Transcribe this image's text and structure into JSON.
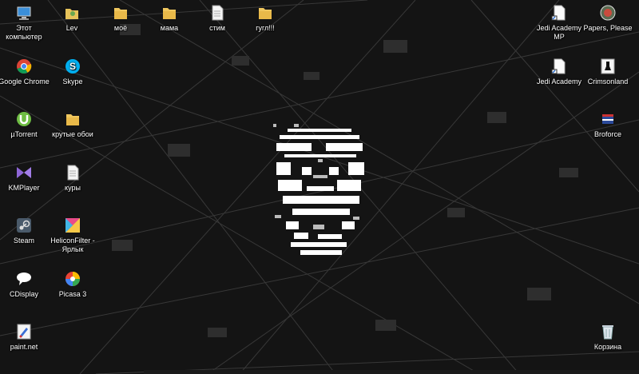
{
  "desktop": {
    "icons_left": [
      {
        "label": "Этот компьютер",
        "icon": "computer-icon"
      },
      {
        "label": "Lev",
        "icon": "user-folder-icon"
      },
      {
        "label": "моё",
        "icon": "folder-icon"
      },
      {
        "label": "мама",
        "icon": "folder-icon"
      },
      {
        "label": "стим",
        "icon": "text-file-icon"
      },
      {
        "label": "гугл!!!",
        "icon": "folder-icon"
      }
    ],
    "icons_col1": [
      {
        "label": "Google Chrome",
        "icon": "chrome-icon"
      },
      {
        "label": "µTorrent",
        "icon": "utorrent-icon"
      },
      {
        "label": "KMPlayer",
        "icon": "kmplayer-icon"
      },
      {
        "label": "Steam",
        "icon": "steam-icon"
      },
      {
        "label": "CDisplay",
        "icon": "cdisplay-icon"
      },
      {
        "label": "paint.net",
        "icon": "paintnet-icon"
      }
    ],
    "icons_col2": [
      {
        "label": "Skype",
        "icon": "skype-icon"
      },
      {
        "label": "крутые обои",
        "icon": "folder-icon"
      },
      {
        "label": "куры",
        "icon": "text-file-icon"
      },
      {
        "label": "HeliconFilter - Ярлык",
        "icon": "heliconfilter-icon"
      },
      {
        "label": "Picasa 3",
        "icon": "picasa-icon"
      }
    ],
    "icons_right": [
      {
        "label": "Jedi Academy MP",
        "icon": "document-icon"
      },
      {
        "label": "Papers, Please",
        "icon": "papers-please-icon"
      },
      {
        "label": "Jedi Academy",
        "icon": "document-icon"
      },
      {
        "label": "Crimsonland",
        "icon": "crimsonland-icon"
      },
      {
        "label": "Broforce",
        "icon": "broforce-icon"
      },
      {
        "label": "Корзина",
        "icon": "recycle-bin-icon"
      }
    ]
  },
  "wallpaper": {
    "theme": "dark network lines with ascii-art mask",
    "background_color": "#141414",
    "line_color": "#3a3a3a"
  }
}
